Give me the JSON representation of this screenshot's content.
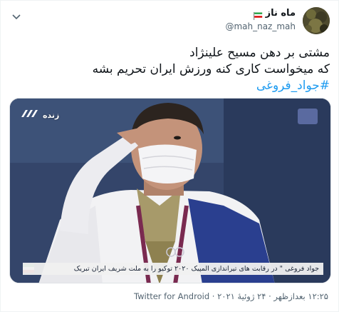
{
  "author": {
    "display_name": "ماه ناز",
    "handle": "@mah_naz_mah"
  },
  "tweet": {
    "lines": [
      "مشتی بر دهن مسیح علینژاد",
      "که میخواست کاری کنه ورزش ایران تحریم بشه"
    ],
    "hashtag": "#جواد_فروغی"
  },
  "media": {
    "live_label": "زنده",
    "ticker_text": "جواد فروغی \" در رقابت های تیراندازی المپیک ۲۰۲۰ توکیو را به ملت شریف ایران تبریک"
  },
  "footer": {
    "timestamp": "۱۲:۲۵ بعدازظهر · ۲۴ ژوئیهٔ ۲۰۲۱",
    "source": "Twitter for Android"
  },
  "colors": {
    "link": "#1d9bf0",
    "secondary_text": "#536471"
  },
  "icons": {
    "menu": "chevron-down-icon",
    "flag": "flag-icon",
    "live": "channel-logo-icon"
  }
}
